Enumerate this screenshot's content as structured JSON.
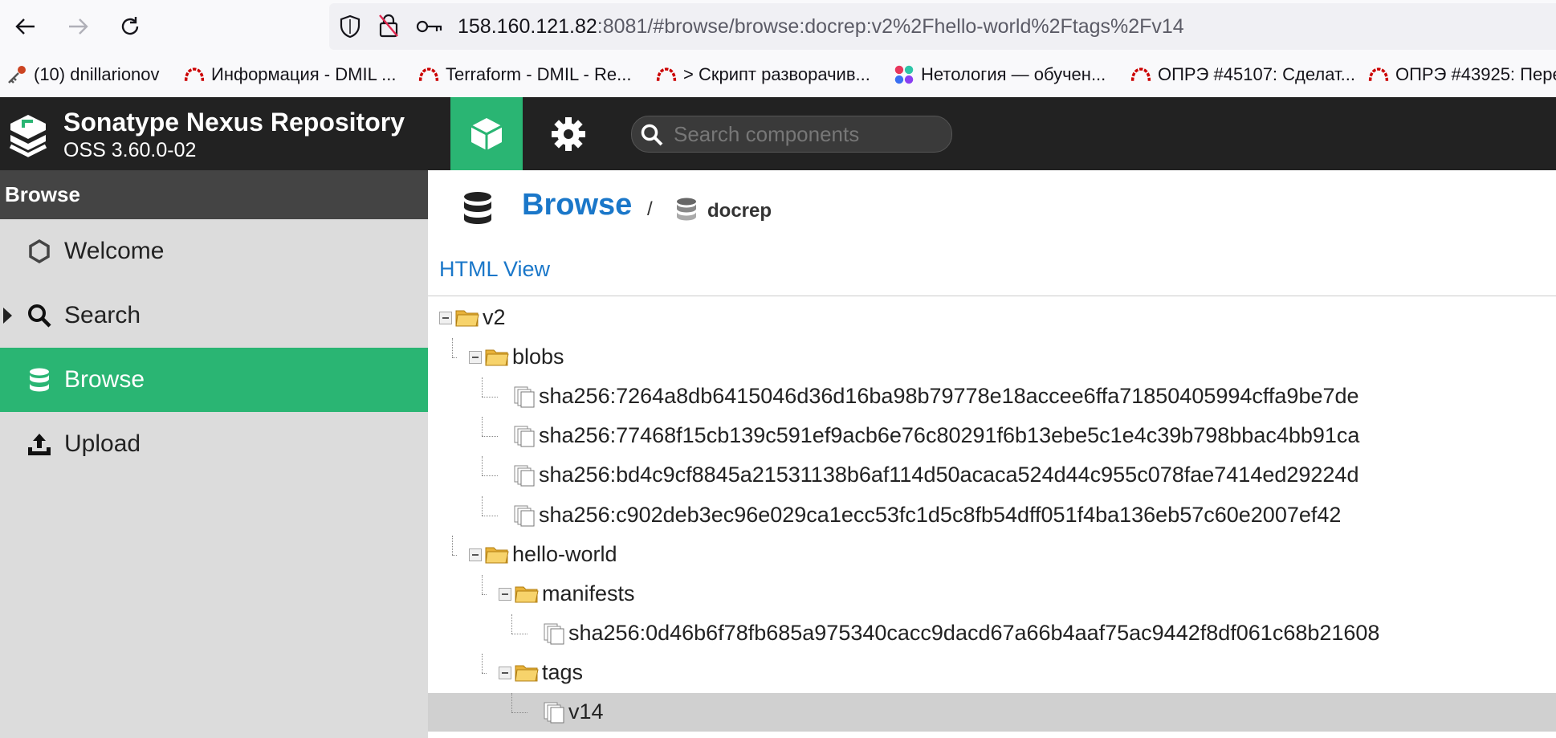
{
  "browser": {
    "url_host": "158.160.121.82",
    "url_rest": ":8081/#browse/browse:docrep:v2%2Fhello-world%2Ftags%2Fv14"
  },
  "bookmarks": [
    {
      "label": "(10) dnillarionov",
      "icon": "key-icon"
    },
    {
      "label": "Информация - DMIL ...",
      "icon": "redhat-icon"
    },
    {
      "label": "Terraform - DMIL - Re...",
      "icon": "redhat-icon"
    },
    {
      "label": "> Скрипт разворачив...",
      "icon": "redhat-icon"
    },
    {
      "label": "Нетология — обучен...",
      "icon": "netology-icon"
    },
    {
      "label": "ОПРЭ #45107: Сделат...",
      "icon": "redhat-icon"
    },
    {
      "label": "ОПРЭ #43925: Пере",
      "icon": "redhat-icon"
    }
  ],
  "header": {
    "title": "Sonatype Nexus Repository",
    "version": "OSS 3.60.0-02",
    "search_placeholder": "Search components"
  },
  "sidebar": {
    "header": "Browse",
    "items": [
      {
        "label": "Welcome",
        "icon": "hexagon-icon",
        "active": false
      },
      {
        "label": "Search",
        "icon": "search-icon",
        "active": false
      },
      {
        "label": "Browse",
        "icon": "database-icon",
        "active": true
      },
      {
        "label": "Upload",
        "icon": "upload-icon",
        "active": false
      }
    ]
  },
  "main": {
    "breadcrumb_title": "Browse",
    "breadcrumb_sep": "/",
    "repo_name": "docrep",
    "html_view": "HTML View",
    "tree": [
      {
        "label": "v2",
        "type": "folder",
        "depth": 0
      },
      {
        "label": "blobs",
        "type": "folder",
        "depth": 1
      },
      {
        "label": "sha256:7264a8db6415046d36d16ba98b79778e18accee6ffa71850405994cffa9be7de",
        "type": "file",
        "depth": 2
      },
      {
        "label": "sha256:77468f15cb139c591ef9acb6e76c80291f6b13ebe5c1e4c39b798bbac4bb91ca",
        "type": "file",
        "depth": 2
      },
      {
        "label": "sha256:bd4c9cf8845a21531138b6af114d50acaca524d44c955c078fae7414ed29224d",
        "type": "file",
        "depth": 2
      },
      {
        "label": "sha256:c902deb3ec96e029ca1ecc53fc1d5c8fb54dff051f4ba136eb57c60e2007ef42",
        "type": "file",
        "depth": 2
      },
      {
        "label": "hello-world",
        "type": "folder",
        "depth": 1
      },
      {
        "label": "manifests",
        "type": "folder",
        "depth": 2
      },
      {
        "label": "sha256:0d46b6f78fb685a975340cacc9dacd67a66b4aaf75ac9442f8df061c68b21608",
        "type": "file",
        "depth": 3
      },
      {
        "label": "tags",
        "type": "folder",
        "depth": 2
      },
      {
        "label": "v14",
        "type": "file",
        "depth": 3,
        "selected": true
      }
    ]
  }
}
